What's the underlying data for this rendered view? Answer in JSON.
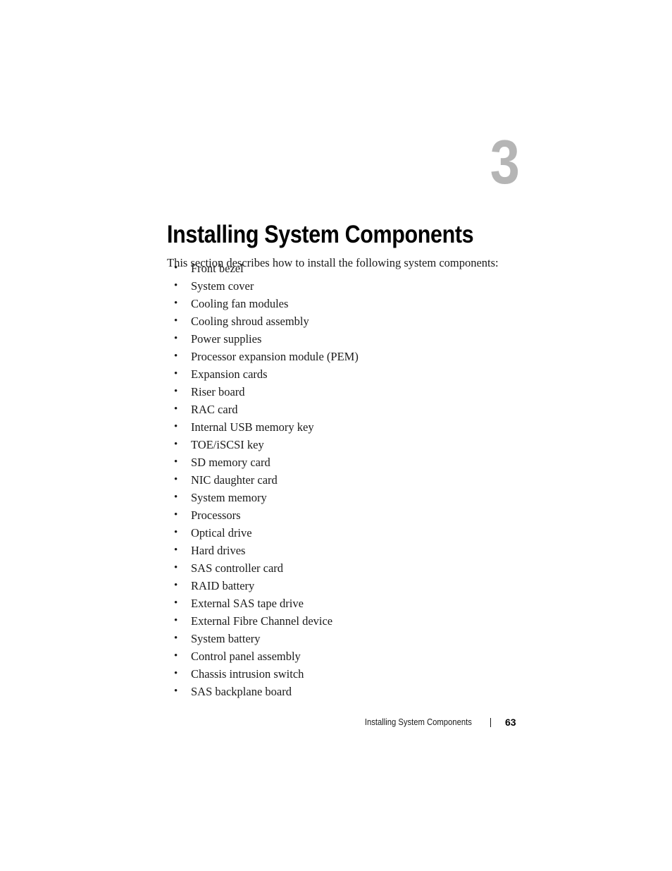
{
  "document": {
    "chapter_number": "3",
    "chapter_title": "Installing System Components",
    "intro_paragraph": "This section describes how to install the following system components:",
    "bullet_glyph": "•",
    "components": [
      "Front bezel",
      "System cover",
      "Cooling fan modules",
      "Cooling shroud assembly",
      "Power supplies",
      "Processor expansion module (PEM)",
      "Expansion cards",
      "Riser board",
      "RAC card",
      "Internal USB memory key",
      "TOE/iSCSI key",
      "SD memory card",
      "NIC daughter card",
      "System memory",
      "Processors",
      "Optical drive",
      "Hard drives",
      "SAS controller card",
      "RAID battery",
      "External SAS tape drive",
      "External Fibre Channel device",
      "System battery",
      "Control panel assembly",
      "Chassis intrusion switch",
      "SAS backplane board"
    ]
  },
  "footer": {
    "running_title": "Installing System Components",
    "page_number": "63"
  },
  "colors": {
    "page_background": "#ffffff",
    "body_text": "#1a1a1a",
    "heading_text": "#000000",
    "chapter_number": "#b5b5b5"
  }
}
